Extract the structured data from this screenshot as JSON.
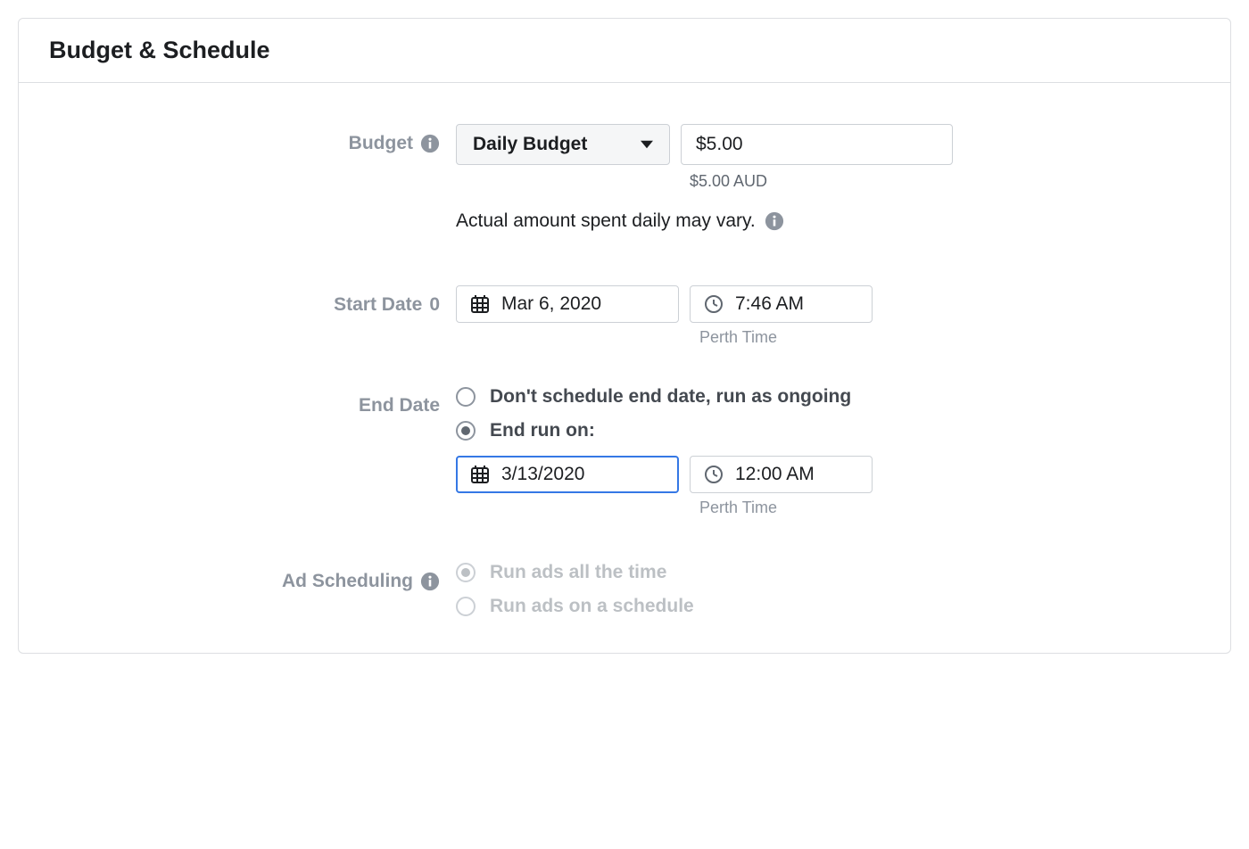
{
  "panel": {
    "title": "Budget & Schedule"
  },
  "budget": {
    "label": "Budget",
    "dropdown": "Daily Budget",
    "amount": "$5.00",
    "amount_helper": "$5.00 AUD",
    "note": "Actual amount spent daily may vary."
  },
  "startDate": {
    "label": "Start Date",
    "date": "Mar 6, 2020",
    "time": "7:46 AM",
    "tz": "Perth Time"
  },
  "endDate": {
    "label": "End Date",
    "option_ongoing": "Don't schedule end date, run as ongoing",
    "option_endrun": "End run on:",
    "date": "3/13/2020",
    "time": "12:00 AM",
    "tz": "Perth Time"
  },
  "adScheduling": {
    "label": "Ad Scheduling",
    "option_all": "Run ads all the time",
    "option_schedule": "Run ads on a schedule"
  }
}
